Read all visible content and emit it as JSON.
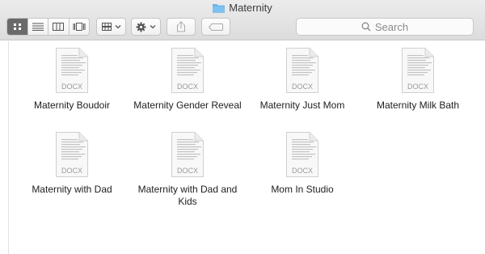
{
  "window": {
    "title": "Maternity"
  },
  "toolbar": {
    "view_buttons": [
      "icon-view",
      "list-view",
      "column-view",
      "cover-flow-view"
    ],
    "search_placeholder": "Search"
  },
  "colors": {
    "folder": "#5fb2ec",
    "active_view": "#6a6a6a"
  },
  "files": [
    {
      "name": "Maternity Boudoir",
      "type": "DOCX"
    },
    {
      "name": "Maternity Gender Reveal",
      "type": "DOCX"
    },
    {
      "name": "Maternity Just Mom",
      "type": "DOCX"
    },
    {
      "name": "Maternity Milk Bath",
      "type": "DOCX"
    },
    {
      "name": "Maternity with Dad",
      "type": "DOCX"
    },
    {
      "name": "Maternity with Dad and Kids",
      "type": "DOCX"
    },
    {
      "name": "Mom In Studio",
      "type": "DOCX"
    }
  ]
}
